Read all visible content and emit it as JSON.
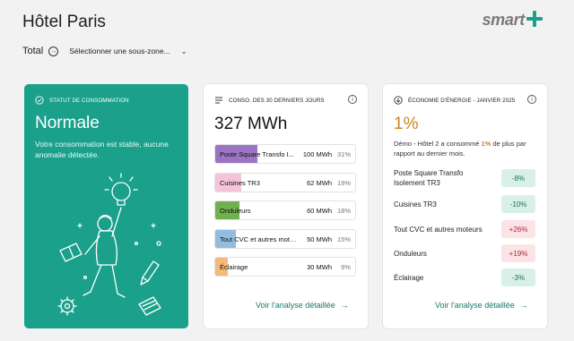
{
  "header": {
    "title": "Hôtel Paris",
    "logo_text": "smart",
    "filter_label": "Total",
    "subzone_placeholder": "Sélectionner une sous-zone..."
  },
  "status_card": {
    "header": "STATUT DE CONSOMMATION",
    "title": "Normale",
    "description": "Votre consommation est stable, aucune anomalie détectée.",
    "color": "#1aa08b"
  },
  "conso_card": {
    "header": "CONSO. DES 30 DERNIERS JOURS",
    "total": "327 MWh",
    "items": [
      {
        "label": "Poste Square Transfo I...",
        "value": "100 MWh",
        "pct": "31%",
        "fill_pct": 31,
        "color": "#9b74c3"
      },
      {
        "label": "Cuisines TR3",
        "value": "62 MWh",
        "pct": "19%",
        "fill_pct": 19,
        "color": "#f5c4d8"
      },
      {
        "label": "Onduleurs",
        "value": "60 MWh",
        "pct": "18%",
        "fill_pct": 18,
        "color": "#6fb04f"
      },
      {
        "label": "Tout CVC et autres mote...",
        "value": "50 MWh",
        "pct": "15%",
        "fill_pct": 15,
        "color": "#93bde0"
      },
      {
        "label": "Éclairage",
        "value": "30 MWh",
        "pct": "9%",
        "fill_pct": 9,
        "color": "#f6b97a"
      }
    ],
    "link": "Voir l'analyse détaillée"
  },
  "eco_card": {
    "header": "ÉCONOMIE D'ÉNERGIE - JANVIER 2025",
    "value": "1%",
    "desc_before": "Démo - Hôtel 2 a consommé",
    "desc_highlight": "1%",
    "desc_after": "de plus par rapport au dernier mois.",
    "items": [
      {
        "label": "Poste Square Transfo Isolement TR3",
        "badge": "-8%",
        "trend": "down"
      },
      {
        "label": "Cuisines TR3",
        "badge": "-10%",
        "trend": "down"
      },
      {
        "label": "Tout CVC et autres moteurs",
        "badge": "+26%",
        "trend": "up"
      },
      {
        "label": "Onduleurs",
        "badge": "+19%",
        "trend": "up"
      },
      {
        "label": "Éclairage",
        "badge": "-3%",
        "trend": "down"
      }
    ],
    "link": "Voir l'analyse détaillée"
  },
  "icons": {
    "filter_arrow": "arrow-circle-right-icon",
    "status": "check-circle-icon",
    "conso": "list-icon",
    "eco": "download-circle-icon",
    "info": "info-icon",
    "link_arrow": "arrow-right-icon"
  },
  "colors": {
    "accent": "#1aa08b",
    "eco_value": "#c9861b",
    "link": "#147a6b"
  }
}
